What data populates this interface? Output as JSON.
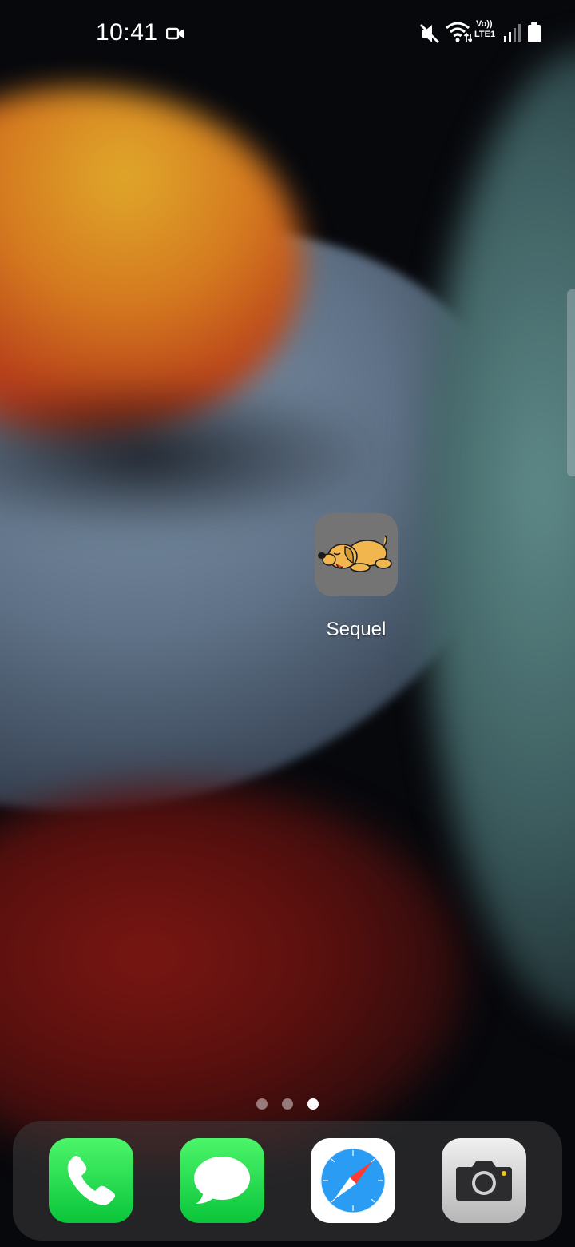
{
  "status_bar": {
    "time": "10:41",
    "network_top": "Vo))",
    "network_bottom": "LTE1",
    "icons": [
      "video-recording-icon",
      "mute-icon",
      "wifi-icon",
      "signal-icon",
      "battery-icon"
    ]
  },
  "home": {
    "apps": [
      {
        "label": "Sequel",
        "icon": "sleeping-dog-icon"
      }
    ],
    "page_count": 3,
    "active_page": 3
  },
  "dock": {
    "apps": [
      {
        "name": "Phone",
        "icon": "phone-icon",
        "color": "#0ac53a"
      },
      {
        "name": "Messages",
        "icon": "message-bubble-icon",
        "color": "#0ac53a"
      },
      {
        "name": "Safari",
        "icon": "compass-icon",
        "color": "#1e8ff0"
      },
      {
        "name": "Camera",
        "icon": "camera-icon",
        "color": "#b6b6b6"
      }
    ]
  }
}
